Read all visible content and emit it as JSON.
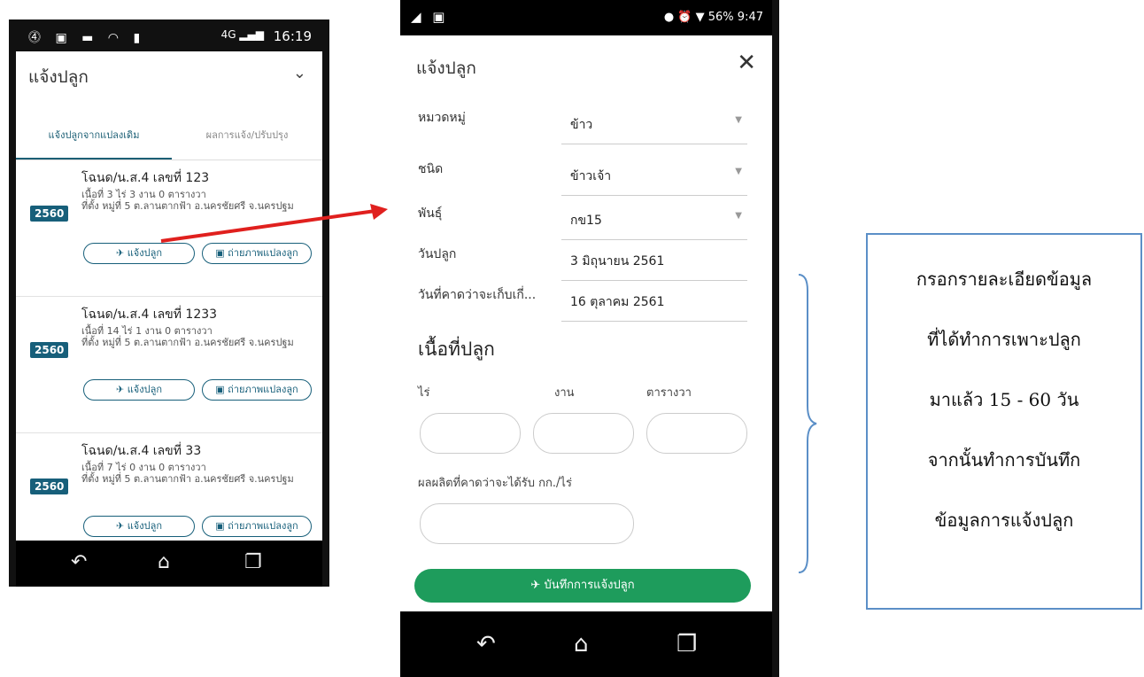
{
  "phone1": {
    "status": {
      "left_icons": "⓸ ▣ ▬ ◠ ▮",
      "signal": "4G ▂▄▆",
      "time": "16:19"
    },
    "title": "แจ้งปลูก",
    "tabs": [
      "แจ้งปลูกจากแปลงเดิม",
      "ผลการแจ้ง/ปรับปรุง"
    ],
    "cards": [
      {
        "deed": "โฉนด/น.ส.4 เลขที่ 123",
        "area": "เนื้อที่ 3 ไร่ 3 งาน 0 ตารางวา",
        "location": "ที่ตั้ง หมู่ที่ 5 ต.ลานตากฟ้า อ.นครชัยศรี จ.นครปฐม",
        "year": "2560",
        "btn_report": "แจ้งปลูก",
        "btn_photo": "ถ่ายภาพแปลงลูก"
      },
      {
        "deed": "โฉนด/น.ส.4 เลขที่ 1233",
        "area": "เนื้อที่ 14 ไร่ 1 งาน 0 ตารางวา",
        "location": "ที่ตั้ง หมู่ที่ 5 ต.ลานตากฟ้า อ.นครชัยศรี จ.นครปฐม",
        "year": "2560",
        "btn_report": "แจ้งปลูก",
        "btn_photo": "ถ่ายภาพแปลงลูก"
      },
      {
        "deed": "โฉนด/น.ส.4 เลขที่ 33",
        "area": "เนื้อที่ 7 ไร่ 0 งาน 0 ตารางวา",
        "location": "ที่ตั้ง หมู่ที่ 5 ต.ลานตากฟ้า อ.นครชัยศรี จ.นครปฐม",
        "year": "2560",
        "btn_report": "แจ้งปลูก",
        "btn_photo": "ถ่ายภาพแปลงลูก"
      }
    ]
  },
  "phone2": {
    "status": {
      "time": "9:47",
      "battery": "56%"
    },
    "title": "แจ้งปลูก",
    "fields": [
      {
        "label": "หมวดหมู่",
        "value": "ข้าว",
        "dropdown": true
      },
      {
        "label": "ชนิด",
        "value": "ข้าวเจ้า",
        "dropdown": true
      },
      {
        "label": "พันธุ์",
        "value": "กข15",
        "dropdown": true
      },
      {
        "label": "วันปลูก",
        "value": "3 มิถุนายน 2561",
        "dropdown": false
      },
      {
        "label": "วันที่คาดว่าจะเก็บเกี่...",
        "value": "16 ตุลาคม 2561",
        "dropdown": false
      }
    ],
    "area_title": "เนื้อที่ปลูก",
    "units": [
      "ไร่",
      "งาน",
      "ตารางวา"
    ],
    "yield_label": "ผลผลิตที่คาดว่าจะได้รับ กก./ไร่",
    "save_button": "บันทึกการแจ้งปลูก"
  },
  "note": {
    "lines": [
      "กรอกรายละเอียดข้อมูล",
      "ที่ได้ทำการเพาะปลูก",
      "มาแล้ว 15 - 60 วัน",
      "จากนั้นทำการบันทึก",
      "ข้อมูลการแจ้งปลูก"
    ]
  },
  "colors": {
    "teal": "#175f7a",
    "green": "#1e9c5c",
    "note_border": "#5b8fc7",
    "arrow": "#e0201e"
  },
  "icons": [
    "back-icon",
    "home-icon",
    "recent-apps-icon",
    "send-icon",
    "photo-icon",
    "close-icon",
    "chevron-down-icon",
    "dropdown-caret-icon"
  ]
}
